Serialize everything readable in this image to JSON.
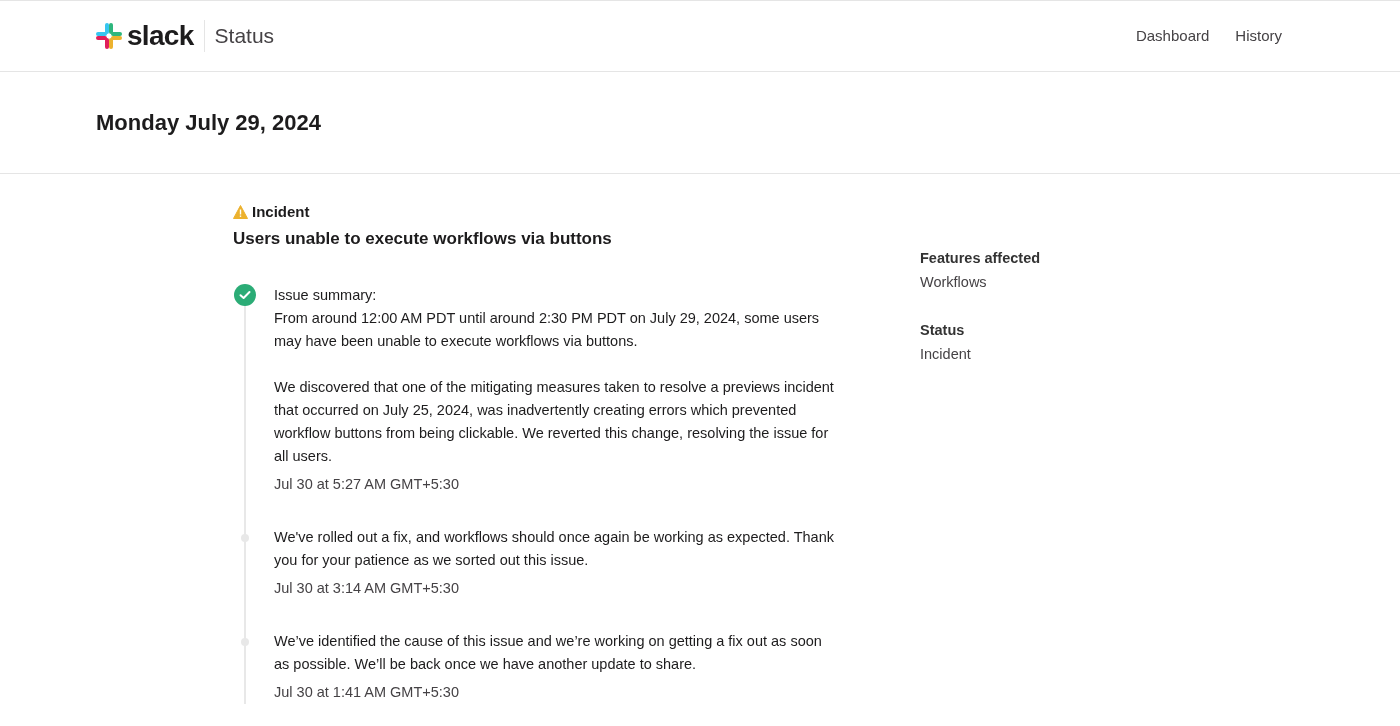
{
  "header": {
    "logo_text": "slack",
    "product": "Status",
    "nav": [
      {
        "label": "Dashboard"
      },
      {
        "label": "History"
      }
    ]
  },
  "date": "Monday July 29, 2024",
  "incident": {
    "label": "Incident",
    "title": "Users unable to execute workflows via buttons",
    "updates": [
      {
        "kind": "resolved",
        "blocks": [
          [
            "Issue summary:",
            "From around 12:00 AM PDT until around 2:30 PM PDT on July 29, 2024, some users may have been unable to execute workflows via buttons."
          ],
          [
            "We discovered that one of the mitigating measures taken to resolve a previews incident that occurred on July 25, 2024, was inadvertently creating errors which prevented workflow buttons from being clickable. We reverted this change, resolving the issue for all users."
          ]
        ],
        "time": "Jul 30 at 5:27 AM GMT+5:30"
      },
      {
        "kind": "update",
        "blocks": [
          [
            "We've rolled out a fix, and workflows should once again be working as expected. Thank you for your patience as we sorted out this issue."
          ]
        ],
        "time": "Jul 30 at 3:14 AM GMT+5:30"
      },
      {
        "kind": "update",
        "blocks": [
          [
            "We’ve identified the cause of this issue and we’re working on getting a fix out as soon as possible. We’ll be back once we have another update to share."
          ]
        ],
        "time": "Jul 30 at 1:41 AM GMT+5:30"
      }
    ],
    "details": [
      {
        "heading": "Features affected",
        "value": "Workflows"
      },
      {
        "heading": "Status",
        "value": "Incident"
      }
    ]
  }
}
